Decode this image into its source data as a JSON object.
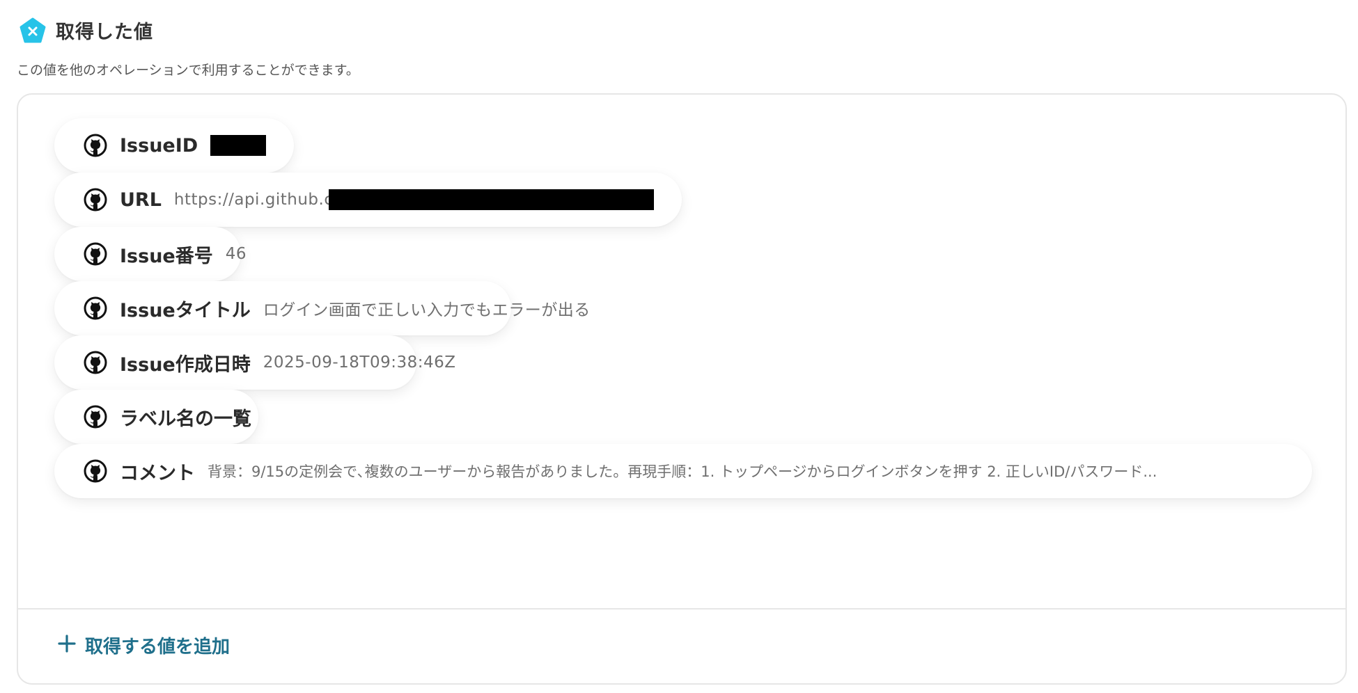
{
  "header": {
    "title": "取得した値",
    "logo_icon": "yoom-pentagon-logo",
    "subtitle": "この値を他のオペレーションで利用することができます。"
  },
  "colors": {
    "logo": "#27c3e8",
    "accent": "#1f6f8b",
    "border": "#e6e6e6"
  },
  "items": [
    {
      "label": "IssueID",
      "value": "",
      "icon": "github-icon"
    },
    {
      "label": "URL",
      "value": "https://api.github.c",
      "icon": "github-icon"
    },
    {
      "label": "Issue番号",
      "value": "46",
      "icon": "github-icon"
    },
    {
      "label": "Issueタイトル",
      "value": "ログイン画面で正しい入力でもエラーが出る",
      "icon": "github-icon"
    },
    {
      "label": "Issue作成日時",
      "value": "2025-09-18T09:38:46Z",
      "icon": "github-icon"
    },
    {
      "label": "ラベル名の一覧",
      "value": "",
      "icon": "github-icon"
    },
    {
      "label": "コメント",
      "value": "背景：9/15の定例会で､複数のユーザーから報告がありました。再現手順：1. トップページからログインボタンを押す 2. 正しいID/パスワード...",
      "icon": "github-icon"
    }
  ],
  "add_button": {
    "label": "取得する値を追加",
    "icon": "plus-icon"
  }
}
